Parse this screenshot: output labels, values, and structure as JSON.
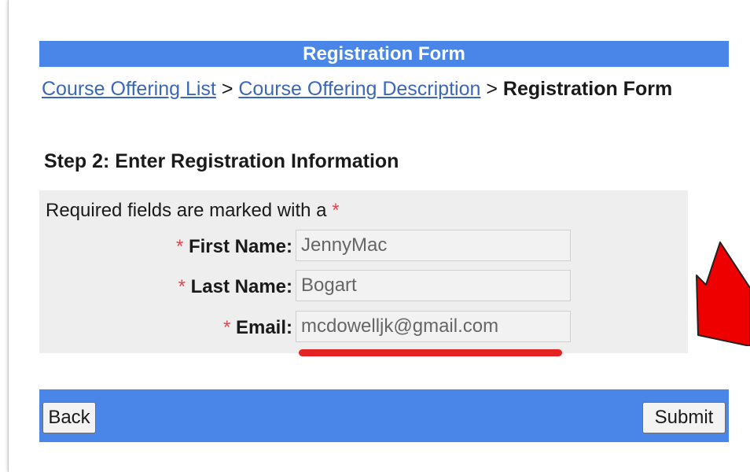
{
  "header": {
    "title": "Registration Form"
  },
  "breadcrumb": {
    "link1": "Course Offering List",
    "sep1": " > ",
    "link2": "Course Offering Description",
    "sep2": " > ",
    "current": "Registration Form"
  },
  "step": {
    "title": "Step 2: Enter Registration Information"
  },
  "form": {
    "required_note": "Required fields are marked with a",
    "asterisk": "*",
    "fields": [
      {
        "label": "First Name:",
        "value": "JennyMac"
      },
      {
        "label": "Last Name:",
        "value": "Bogart"
      },
      {
        "label": "Email:",
        "value": "mcdowelljk@gmail.com"
      }
    ]
  },
  "actions": {
    "back_label": "Back",
    "submit_label": "Submit"
  },
  "annotations": {
    "arrow_color": "#ee0000",
    "underline_color": "#e52222"
  },
  "colors": {
    "accent": "#4a86e8",
    "link": "#3a67b8",
    "required": "#e0484d"
  }
}
